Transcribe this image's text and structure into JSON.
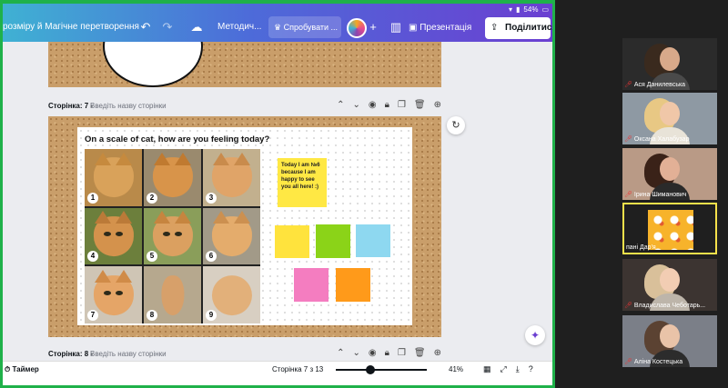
{
  "toolbar": {
    "resize_label": "розміру й Магічне перетворення",
    "project_title": "Методич...",
    "try_label": "Спробувати ...",
    "present_label": "Презентація",
    "share_label": "Поділитися",
    "battery": "54%"
  },
  "pages": {
    "page7_label": "Сторінка: 7 -",
    "page7_placeholder": "Введіть назву сторінки",
    "page8_label": "Сторінка: 8 -",
    "page8_placeholder": "Введіть назву сторінки"
  },
  "whiteboard": {
    "title": "On a scale of cat, how are you feeling today?",
    "note_text": "Today I am №6 because I am happy to see you all here! :)",
    "cat_numbers": [
      "1",
      "2",
      "3",
      "4",
      "5",
      "6",
      "7",
      "8",
      "9"
    ]
  },
  "bottombar": {
    "timer_label": "Таймер",
    "page_counter": "Сторінка 7 з 13",
    "zoom": "41%",
    "zoom_level": 0.41
  },
  "participants": [
    {
      "name": "Ася Данилевська",
      "muted": true
    },
    {
      "name": "Оксана Халабузар",
      "muted": true
    },
    {
      "name": "Ірина Шиманович",
      "muted": true
    },
    {
      "name": "пані Дар'я",
      "muted": false
    },
    {
      "name": "Владислава Чеботарь...",
      "muted": true
    },
    {
      "name": "Аліна Костецька",
      "muted": true
    }
  ],
  "colors": {
    "share_border": "#1fb14a",
    "active_speaker": "#f6e14b",
    "sticky_yellow": "#ffe33d",
    "sticky_green": "#8bd318",
    "sticky_blue": "#8ed8f0",
    "sticky_pink": "#f47dc0",
    "sticky_orange": "#ff9a1a"
  }
}
